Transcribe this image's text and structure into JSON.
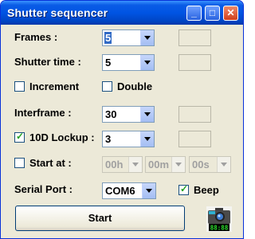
{
  "window": {
    "title": "Shutter sequencer"
  },
  "frames": {
    "label": "Frames :",
    "value": "5"
  },
  "shutter_time": {
    "label": "Shutter time :",
    "value": "5"
  },
  "increment": {
    "label": "Increment",
    "checked": false
  },
  "double": {
    "label": "Double",
    "checked": false
  },
  "interframe": {
    "label": "Interframe :",
    "value": "30"
  },
  "lockup": {
    "label": "10D Lockup :",
    "value": "3",
    "checked": true
  },
  "start_at": {
    "label": "Start at :",
    "checked": false,
    "hours": "00h",
    "minutes": "00m",
    "seconds": "00s"
  },
  "serial_port": {
    "label": "Serial Port :",
    "value": "COM6"
  },
  "beep": {
    "label": "Beep",
    "checked": true
  },
  "start_button": {
    "label": "Start"
  },
  "clock_display": "88:88"
}
